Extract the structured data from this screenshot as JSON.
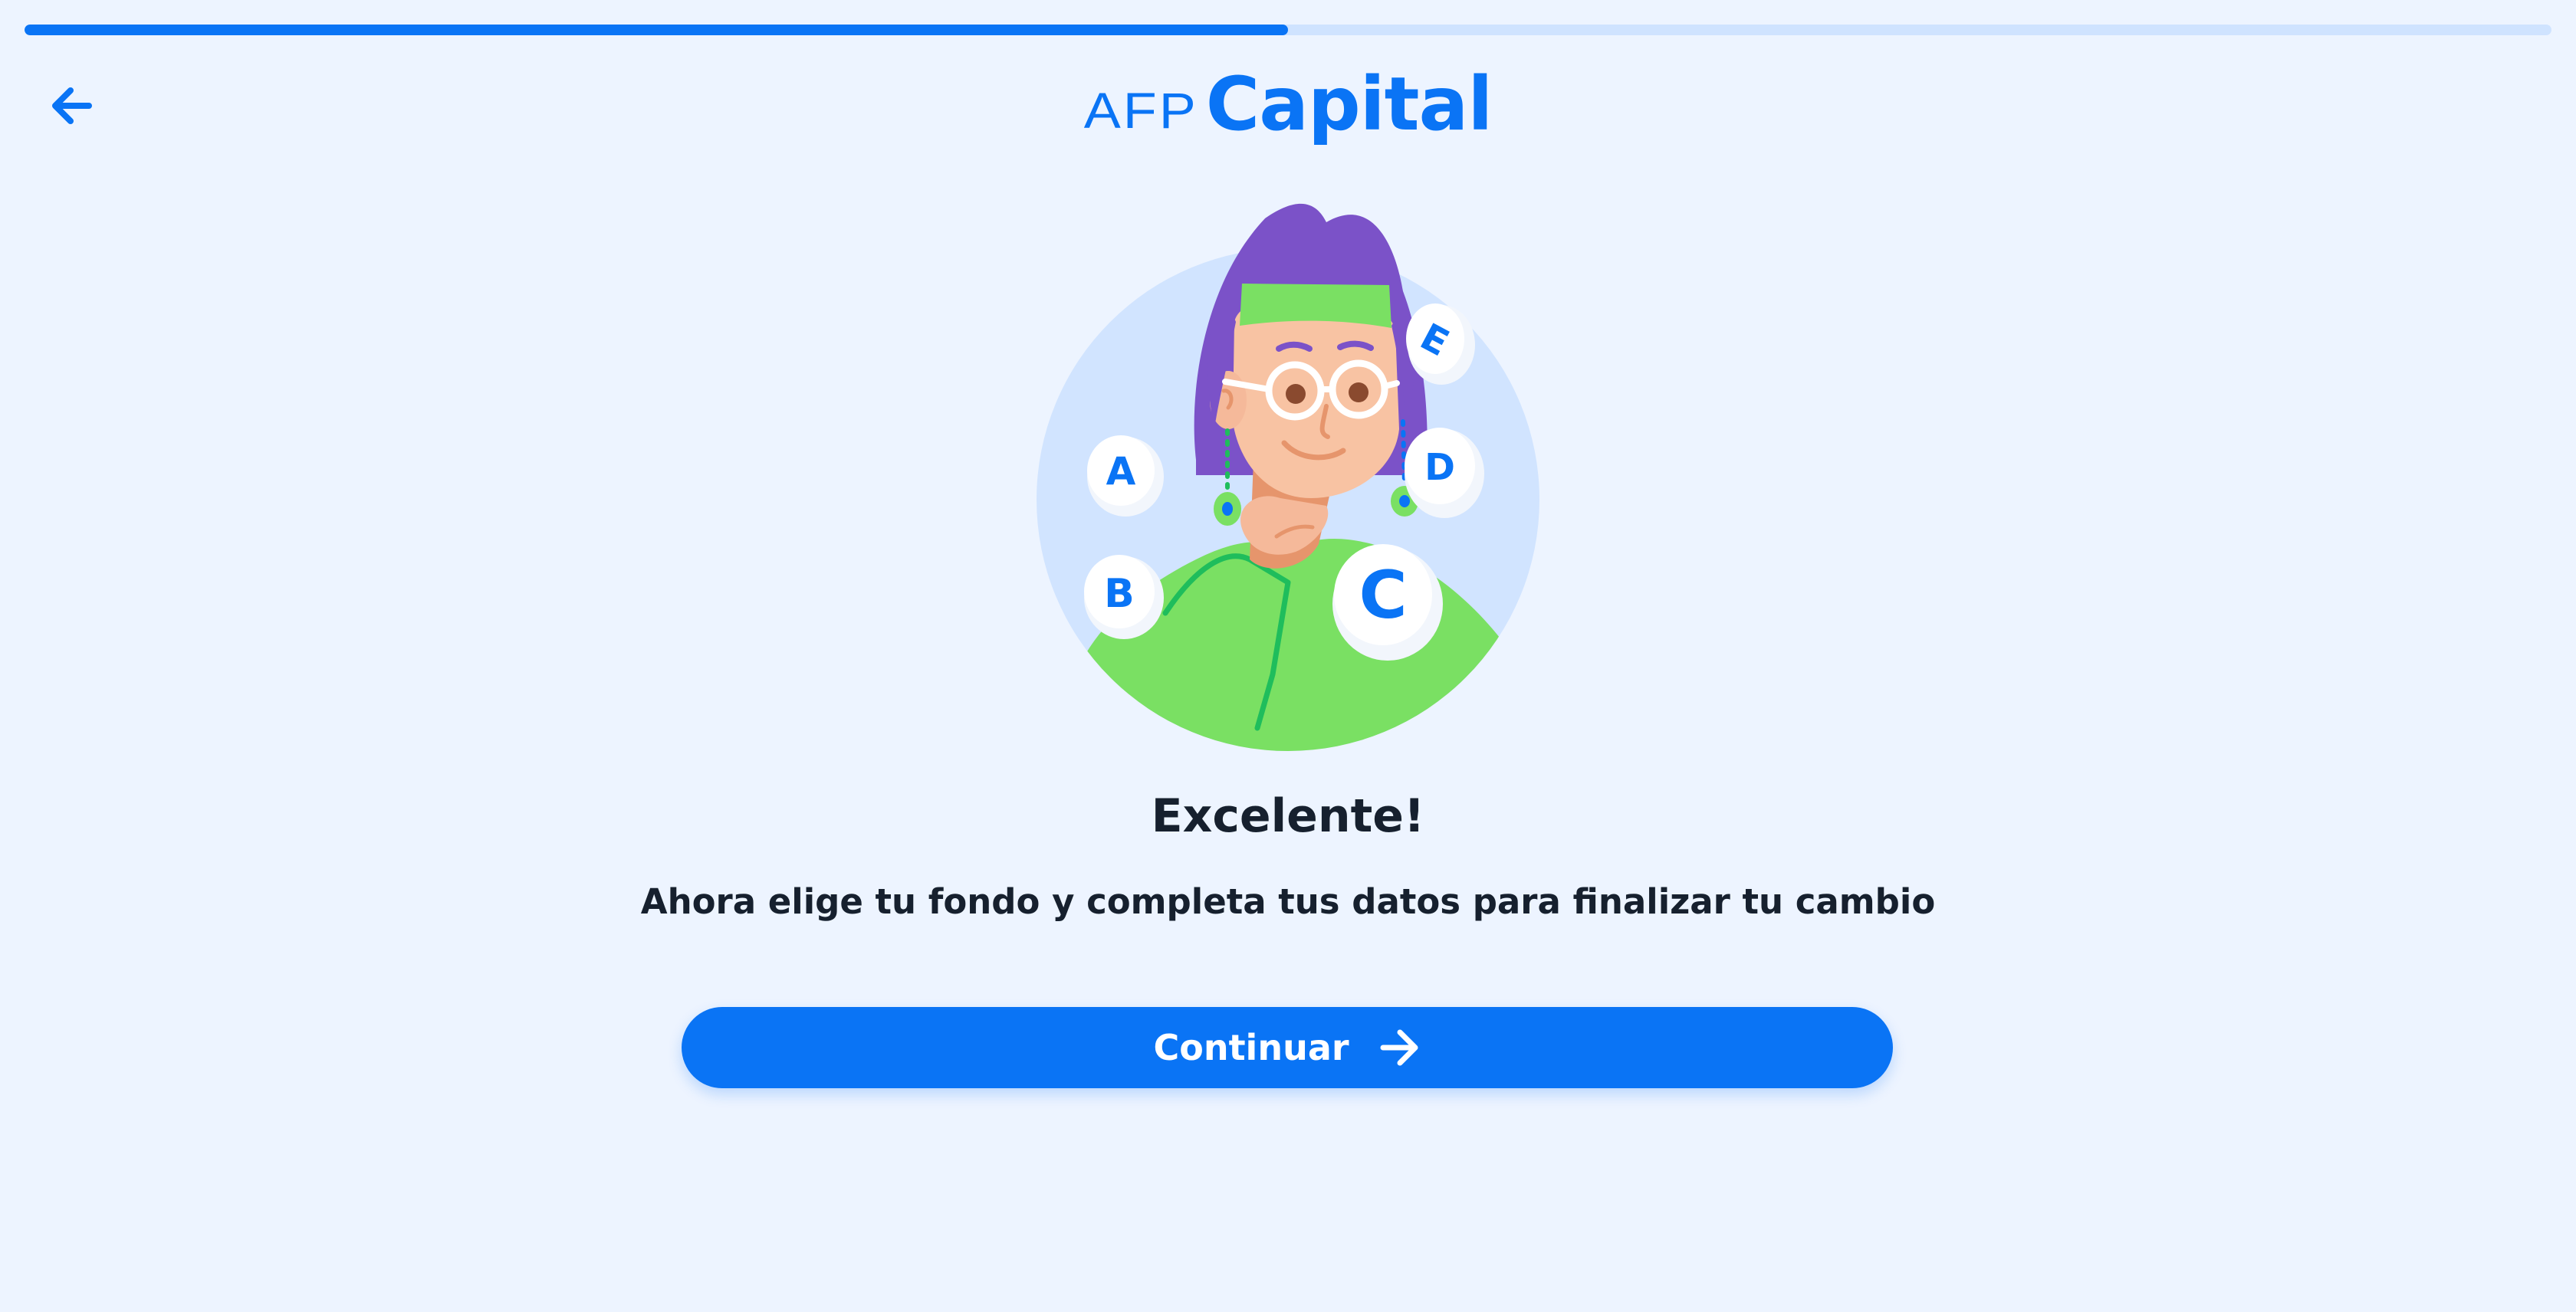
{
  "progress": {
    "value": 0.5
  },
  "header": {
    "back_icon": "arrow-left-icon",
    "logo": {
      "prefix": "AFP",
      "name": "Capital"
    }
  },
  "illustration": {
    "description_icon": "woman-thinking-illustration",
    "fund_letters": [
      "A",
      "B",
      "C",
      "D",
      "E"
    ]
  },
  "content": {
    "title": "Excelente!",
    "subtitle": "Ahora elige tu fondo y completa tus datos para finalizar tu cambio"
  },
  "actions": {
    "continue_label": "Continuar",
    "continue_icon": "arrow-right-icon"
  },
  "colors": {
    "brand": "#0a74f5",
    "background": "#edf4ff",
    "progress_track": "#cfe3ff",
    "text": "#16202e"
  }
}
